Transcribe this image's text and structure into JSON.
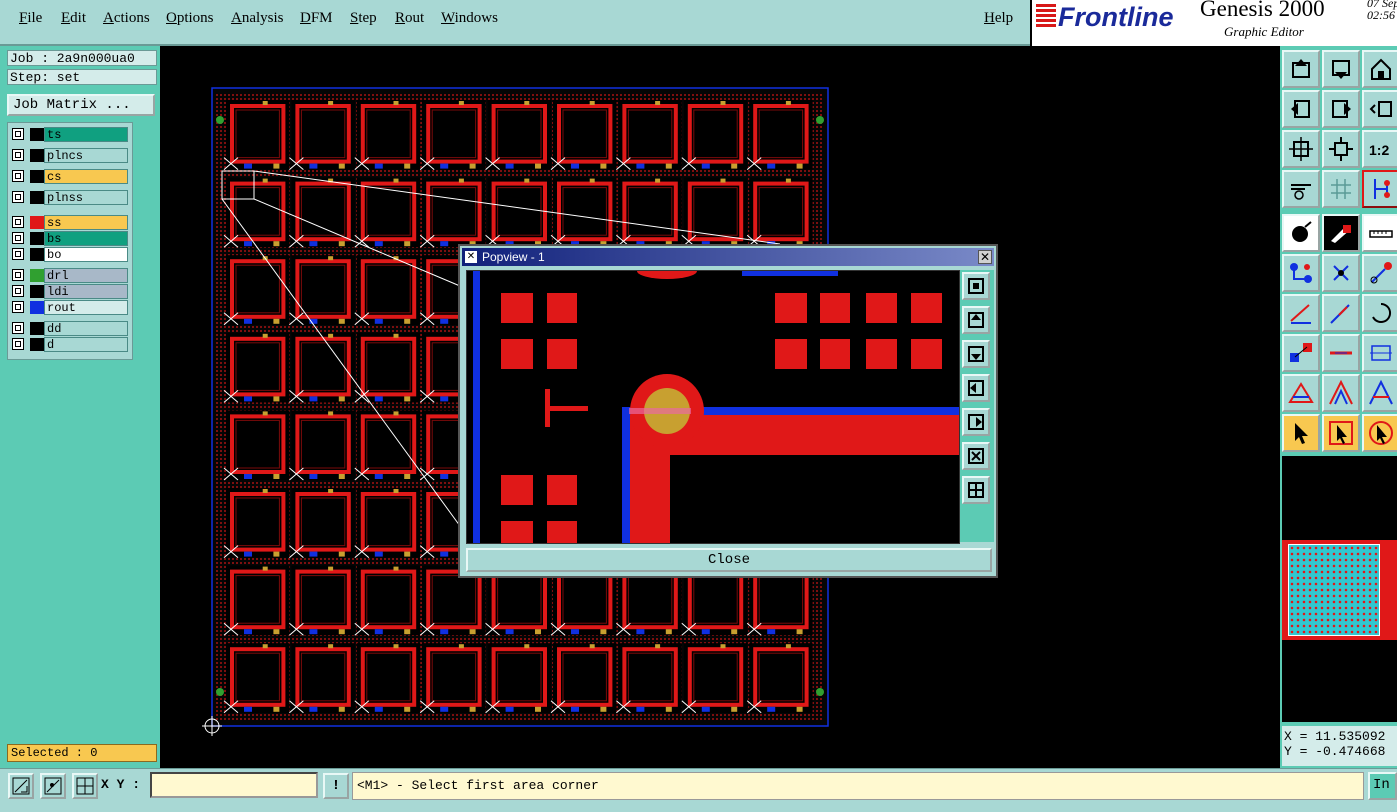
{
  "menu": {
    "items": [
      "File",
      "Edit",
      "Actions",
      "Options",
      "Analysis",
      "DFM",
      "Step",
      "Rout",
      "Windows"
    ],
    "help": "Help"
  },
  "brand": {
    "logo": "Frontline",
    "title": "Genesis 2000",
    "subtitle": "Graphic Editor",
    "date": "07 Sep",
    "time": "02:56"
  },
  "job": {
    "job_label": "Job : 2a9n000ua0",
    "step_label": "Step: set",
    "matrix_button": "Job Matrix ..."
  },
  "layers": [
    {
      "name": "ts",
      "swatch": "#000000",
      "bg": "#10a080"
    },
    {
      "name": "plncs",
      "swatch": "#000000",
      "bg": "#a8d8d4"
    },
    {
      "name": "cs",
      "swatch": "#000000",
      "bg": "#f8c850"
    },
    {
      "name": "plnss",
      "swatch": "#000000",
      "bg": "#a8d8d4"
    },
    {
      "name": "ss",
      "swatch": "#e01818",
      "bg": "#f8c850"
    },
    {
      "name": "bs",
      "swatch": "#000000",
      "bg": "#10a080"
    },
    {
      "name": "bo",
      "swatch": "#000000",
      "bg": "#ffffff"
    },
    {
      "name": "drl",
      "swatch": "#30a030",
      "bg": "#a8b8c8"
    },
    {
      "name": "ldi",
      "swatch": "#000000",
      "bg": "#a8b8c8"
    },
    {
      "name": "rout",
      "swatch": "#1030e0",
      "bg": "#d4ecea"
    },
    {
      "name": "dd",
      "swatch": "#000000",
      "bg": "#a8d8d4"
    },
    {
      "name": "d",
      "swatch": "#000000",
      "bg": "#a8d8d4"
    }
  ],
  "selected_label": "Selected : 0",
  "popview": {
    "title": "Popview - 1",
    "close_label": "Close"
  },
  "coords": {
    "x": "X = 11.535092",
    "y": "Y = -0.474668"
  },
  "statusbar": {
    "xy_label": "X Y :",
    "xy_value": "",
    "info_button": "!",
    "prompt": "<M1> - Select first area corner",
    "right_button": "In"
  },
  "colors": {
    "panel": "#5ccbb4",
    "menubar": "#a8d8d4",
    "board_red": "#e01818",
    "rout_blue": "#1030e0",
    "pad_yellow": "#c8a030"
  },
  "board_grid": {
    "cols": 9,
    "rows": 8
  }
}
